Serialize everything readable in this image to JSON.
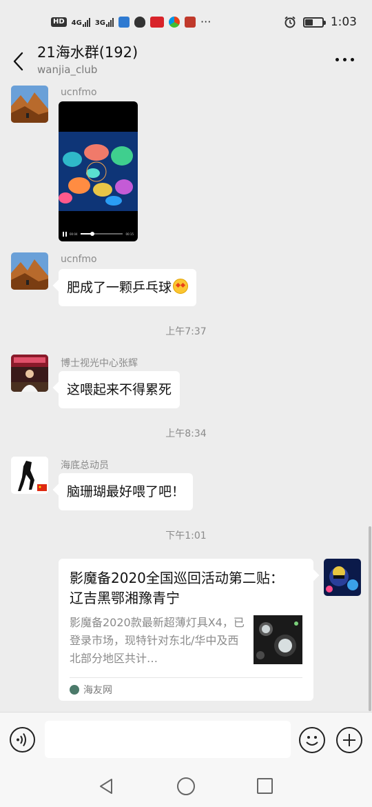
{
  "status_bar": {
    "hd": "HD",
    "signal_1": "4G",
    "signal_2": "3G",
    "dots": "···",
    "time": "1:03",
    "battery_level": 0.45
  },
  "header": {
    "title": "21海水群(192)",
    "subtitle": "wanjia_club"
  },
  "messages": [
    {
      "sender": "ucnfmo",
      "type": "video",
      "video_time_start": "00:04",
      "video_time_end": "00:15",
      "video_progress": 0.28
    },
    {
      "sender": "ucnfmo",
      "type": "text",
      "text": "肥成了一颗乒乓球",
      "emoji": "star-struck-emoji"
    },
    {
      "type": "time",
      "text": "上午7:37"
    },
    {
      "sender": "博士视光中心张辉",
      "type": "text",
      "text": "这喂起来不得累死"
    },
    {
      "type": "time",
      "text": "上午8:34"
    },
    {
      "sender": "海底总动员",
      "type": "text",
      "text": "脑珊瑚最好喂了吧！"
    },
    {
      "type": "time",
      "text": "下午1:01"
    },
    {
      "type": "link_card",
      "title": "影魔备2020全国巡回活动第二贴： 辽吉黑鄂湘豫青宁",
      "description": "影魔备2020款最新超薄灯具X4，已登录市场，现特针对东北/华中及西北部分地区共计…",
      "source": "海友网"
    }
  ],
  "input_bar": {
    "placeholder": ""
  },
  "colors": {
    "background": "#ededed",
    "bubble": "#ffffff",
    "meta_text": "#8a8a8a"
  }
}
